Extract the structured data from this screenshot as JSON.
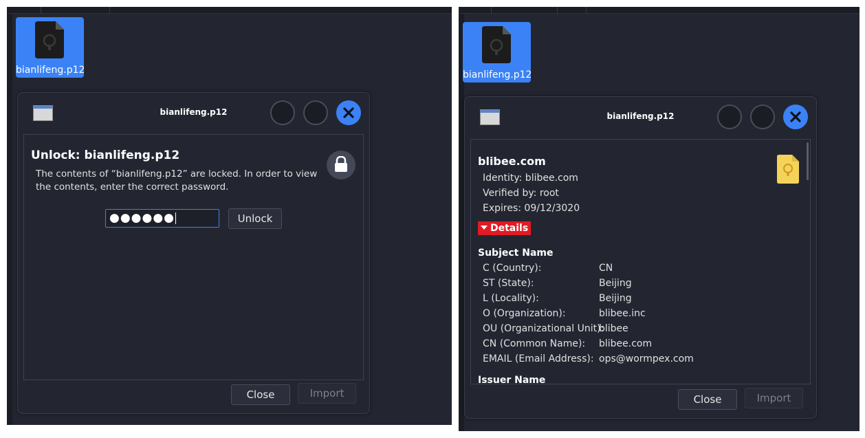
{
  "left": {
    "file_icon_name": "bianlifeng.p12",
    "dialog": {
      "title": "bianlifeng.p12",
      "heading": "Unlock: bianlifeng.p12",
      "description": "The contents of “bianlifeng.p12” are locked. In order to view the contents, enter the correct password.",
      "password_mask": "●●●●●●",
      "unlock_label": "Unlock",
      "close_label": "Close",
      "import_label": "Import"
    }
  },
  "right": {
    "file_icon_name": "bianlifeng.p12",
    "dialog": {
      "title": "bianlifeng.p12",
      "cert_name": "blibee.com",
      "identity": "Identity: blibee.com",
      "verified_by": "Verified by: root",
      "expires": "Expires: 09/12/3020",
      "details_label": "Details",
      "subject_heading": "Subject Name",
      "subject_fields": [
        {
          "label": "C (Country):",
          "value": "CN"
        },
        {
          "label": "ST (State):",
          "value": "Beijing"
        },
        {
          "label": "L (Locality):",
          "value": "Beijing"
        },
        {
          "label": "O (Organization):",
          "value": "blibee.inc"
        },
        {
          "label": "OU (Organizational Unit):",
          "value": "blibee"
        },
        {
          "label": "CN (Common Name):",
          "value": "blibee.com"
        },
        {
          "label": "EMAIL (Email Address):",
          "value": "ops@wormpex.com"
        }
      ],
      "issuer_heading": "Issuer Name",
      "close_label": "Close",
      "import_label": "Import"
    }
  },
  "colors": {
    "accent": "#3b82f6",
    "background": "#232631",
    "details_red": "#e01b24",
    "badge_yellow": "#f5d35a"
  }
}
